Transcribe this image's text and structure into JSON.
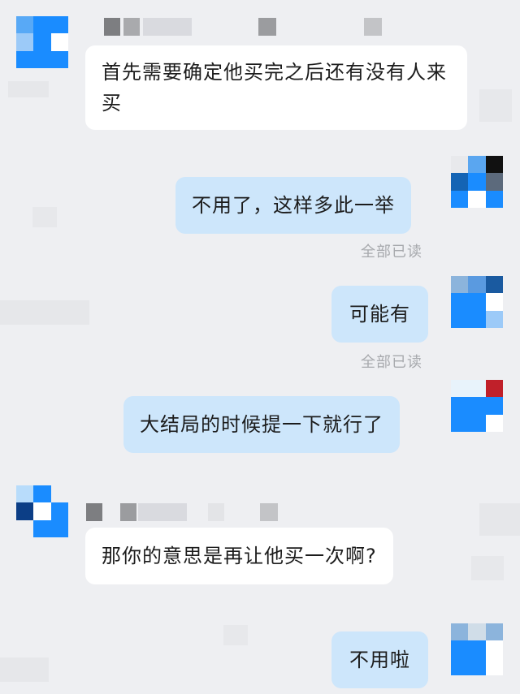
{
  "messages": [
    {
      "side": "in",
      "text": "首先需要确定他买完之后还有没有人来买"
    },
    {
      "side": "out",
      "text": "不用了，这样多此一举",
      "status": "全部已读"
    },
    {
      "side": "out",
      "text": "可能有",
      "status": "全部已读"
    },
    {
      "side": "out",
      "text": "大结局的时候提一下就行了"
    },
    {
      "side": "in",
      "text": "那你的意思是再让他买一次啊?"
    },
    {
      "side": "out",
      "text": "不用啦"
    }
  ],
  "colors": {
    "background": "#eeeff2",
    "incoming_bubble": "#ffffff",
    "outgoing_bubble": "#cde6fb",
    "avatar_blue": "#1a8cff",
    "read_status": "#a7a9ad"
  },
  "icons": [
    "avatar-mosaic-icon"
  ]
}
